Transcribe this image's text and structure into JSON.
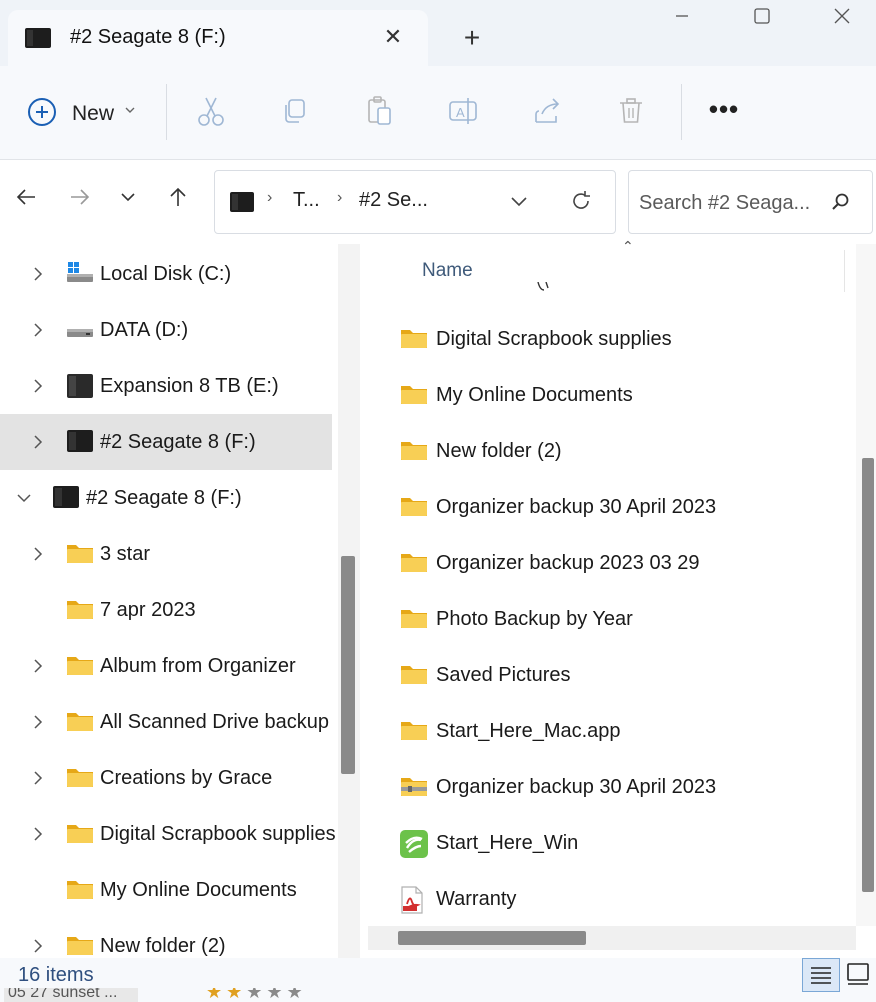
{
  "window": {
    "tab_title": "#2 Seagate 8 (F:)",
    "tab_close": "✕",
    "new_tab": "+",
    "minimize": "—",
    "maximize": "☐",
    "close": "✕"
  },
  "toolbar": {
    "new_label": "New",
    "new_chevron": "⌄",
    "more": "•••"
  },
  "nav": {
    "address_segments": [
      "T...",
      "#2 Se..."
    ],
    "separator": "›",
    "search_placeholder": "Search #2 Seaga..."
  },
  "sidebar": {
    "items": [
      {
        "label": "Local Disk (C:)",
        "icon": "windows-drive-icon",
        "expandable": true
      },
      {
        "label": "DATA (D:)",
        "icon": "drive-icon",
        "expandable": true
      },
      {
        "label": "Expansion 8 TB (E:)",
        "icon": "external-drive-icon",
        "expandable": true
      },
      {
        "label": "#2 Seagate 8 (F:)",
        "icon": "external-drive-icon",
        "expandable": true,
        "selected": true
      },
      {
        "label": "#2 Seagate 8 (F:)",
        "icon": "external-drive-icon",
        "expanded": true
      },
      {
        "label": "3 star",
        "icon": "folder-icon",
        "expandable": true
      },
      {
        "label": "7 apr 2023",
        "icon": "folder-icon",
        "expandable": false
      },
      {
        "label": "Album from Organizer",
        "icon": "folder-icon",
        "expandable": true
      },
      {
        "label": "All Scanned Drive backup",
        "icon": "folder-icon",
        "expandable": true
      },
      {
        "label": "Creations by Grace",
        "icon": "folder-icon",
        "expandable": true
      },
      {
        "label": "Digital Scrapbook supplies",
        "icon": "folder-icon",
        "expandable": true
      },
      {
        "label": "My Online Documents",
        "icon": "folder-icon",
        "expandable": false
      },
      {
        "label": "New folder (2)",
        "icon": "folder-icon",
        "expandable": true
      }
    ]
  },
  "filelist": {
    "column_name": "Name",
    "sort_indicator": "⌃",
    "items": [
      {
        "name": "Digital Scrapbook supplies",
        "icon": "folder-icon"
      },
      {
        "name": "My Online Documents",
        "icon": "folder-icon"
      },
      {
        "name": "New folder (2)",
        "icon": "folder-icon"
      },
      {
        "name": "Organizer backup 30 April 2023",
        "icon": "folder-icon"
      },
      {
        "name": "Organizer backup 2023 03 29",
        "icon": "folder-icon"
      },
      {
        "name": "Photo Backup by Year",
        "icon": "folder-icon"
      },
      {
        "name": "Saved Pictures",
        "icon": "folder-icon"
      },
      {
        "name": "Start_Here_Mac.app",
        "icon": "folder-icon"
      },
      {
        "name": "Organizer backup 30 April 2023",
        "icon": "zip-folder-icon"
      },
      {
        "name": "Start_Here_Win",
        "icon": "seagate-app-icon"
      },
      {
        "name": "Warranty",
        "icon": "pdf-icon"
      }
    ]
  },
  "status": {
    "item_count": "16 items"
  },
  "background_window": {
    "partial_text": "05 27 sunset ...",
    "rating_stars": 2,
    "rating_max": 5
  },
  "colors": {
    "accent": "#1a5fb4",
    "folder": "#f5c542",
    "selected_row": "#e3e3e3",
    "status_text": "#2f4f7f"
  }
}
